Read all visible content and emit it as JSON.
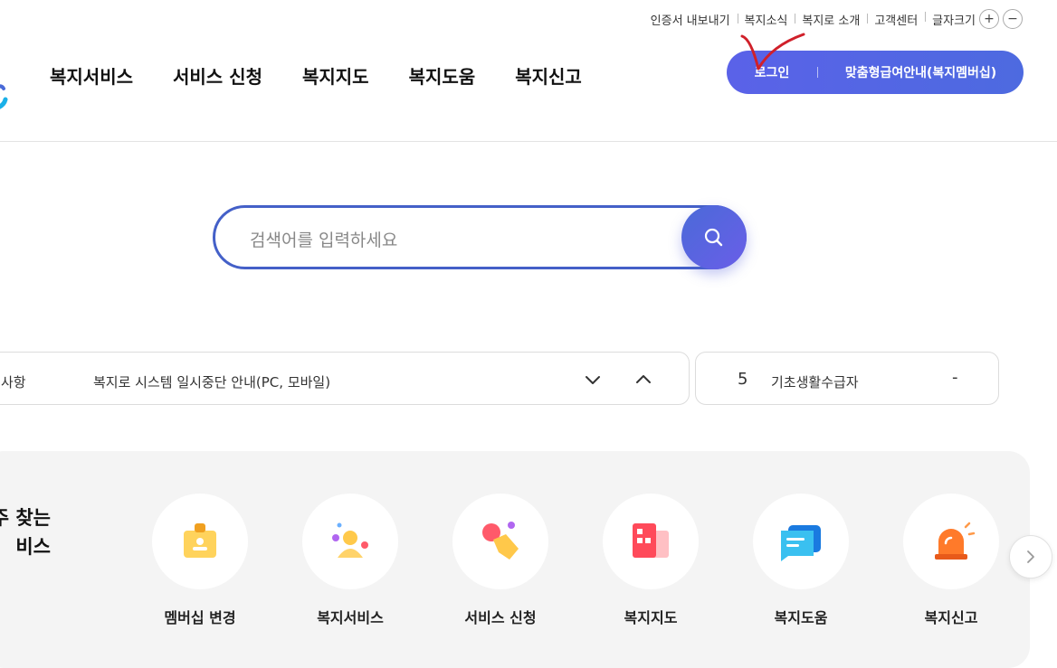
{
  "util_links": [
    "인증서 내보내기",
    "복지소식",
    "복지로 소개",
    "고객센터"
  ],
  "font_size": {
    "label": "글자크기",
    "plus": "+",
    "minus": "−"
  },
  "gnb": [
    "복지서비스",
    "서비스 신청",
    "복지지도",
    "복지도움",
    "복지신고"
  ],
  "login": {
    "label": "로그인",
    "membership": "맞춤형급여안내(복지멤버십)"
  },
  "search": {
    "placeholder": "검색어를 입력하세요"
  },
  "notice": {
    "tag": "사항",
    "text": "복지로 시스템 일시중단 안내(PC, 모바일)"
  },
  "rank": {
    "number": "5",
    "keyword": "기초생활수급자",
    "change": "-"
  },
  "quick": {
    "title_line1": "주 찾는",
    "title_line2": "비스",
    "items": [
      {
        "label": "멤버십 변경",
        "icon": "membership-icon"
      },
      {
        "label": "복지서비스",
        "icon": "welfare-service-icon"
      },
      {
        "label": "서비스 신청",
        "icon": "apply-icon"
      },
      {
        "label": "복지지도",
        "icon": "map-icon"
      },
      {
        "label": "복지도움",
        "icon": "help-icon"
      },
      {
        "label": "복지신고",
        "icon": "report-alarm-icon"
      }
    ]
  },
  "colors": {
    "accent": "#5a62e8",
    "search_border": "#4460c8",
    "annotation": "#d0202a"
  }
}
